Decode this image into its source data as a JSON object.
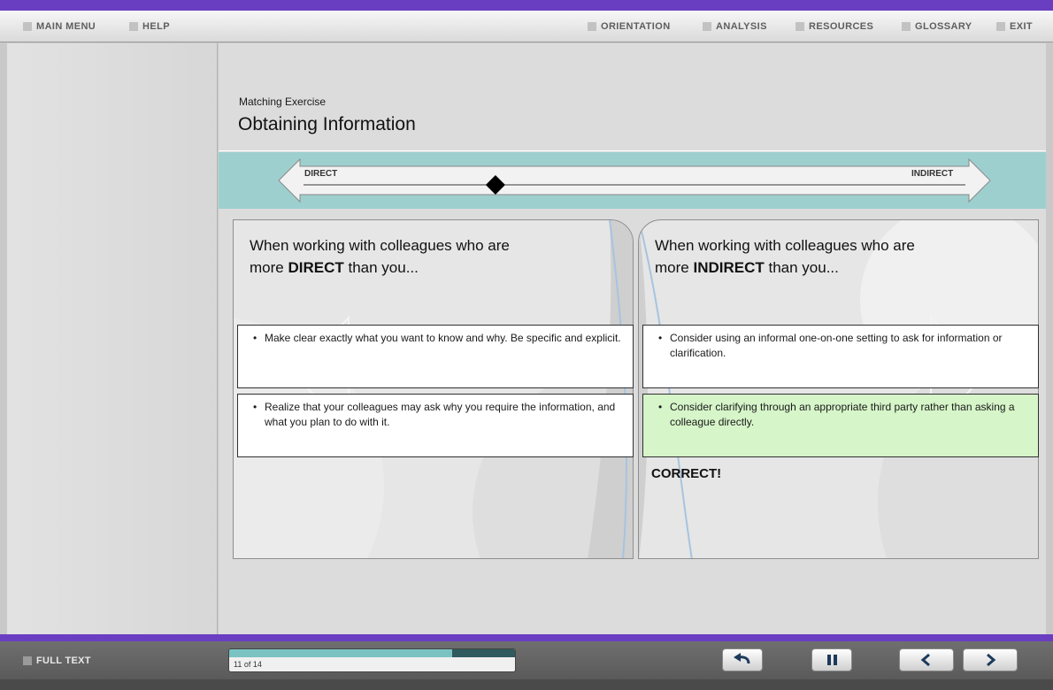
{
  "nav": {
    "left": [
      "MAIN MENU",
      "HELP"
    ],
    "right": [
      "ORIENTATION",
      "ANALYSIS",
      "RESOURCES",
      "GLOSSARY",
      "EXIT"
    ]
  },
  "header": {
    "label": "Matching Exercise",
    "title": "Obtaining Information"
  },
  "scale": {
    "left_label": "DIRECT",
    "right_label": "INDIRECT",
    "marker_position": 0.29
  },
  "panels": {
    "left": {
      "heading_line1": "When working with colleagues who are",
      "heading_pre": "more ",
      "heading_bold": "DIRECT",
      "heading_post": " than you...",
      "items": [
        "Make clear exactly what you want to know and why. Be specific and explicit.",
        "Realize that your colleagues may ask why you require the information, and what you plan to do with it."
      ]
    },
    "right": {
      "heading_line1": "When working with colleagues who are",
      "heading_pre": "more ",
      "heading_bold": "INDIRECT",
      "heading_post": " than you...",
      "items": [
        "Consider using an informal one-on-one setting to ask for information or clarification.",
        "Consider clarifying through an appropriate third party rather than asking a colleague directly."
      ],
      "status": "CORRECT!"
    }
  },
  "footer": {
    "full_text_label": "FULL TEXT",
    "progress_text": "11 of 14",
    "progress_fraction": 0.78,
    "buttons": [
      "replay-icon",
      "pause-icon",
      "back-icon",
      "forward-icon"
    ]
  },
  "colors": {
    "accent_purple": "#6a3ec1",
    "scale_teal": "#9ecfcf",
    "correct_green": "#d6f5c9"
  }
}
